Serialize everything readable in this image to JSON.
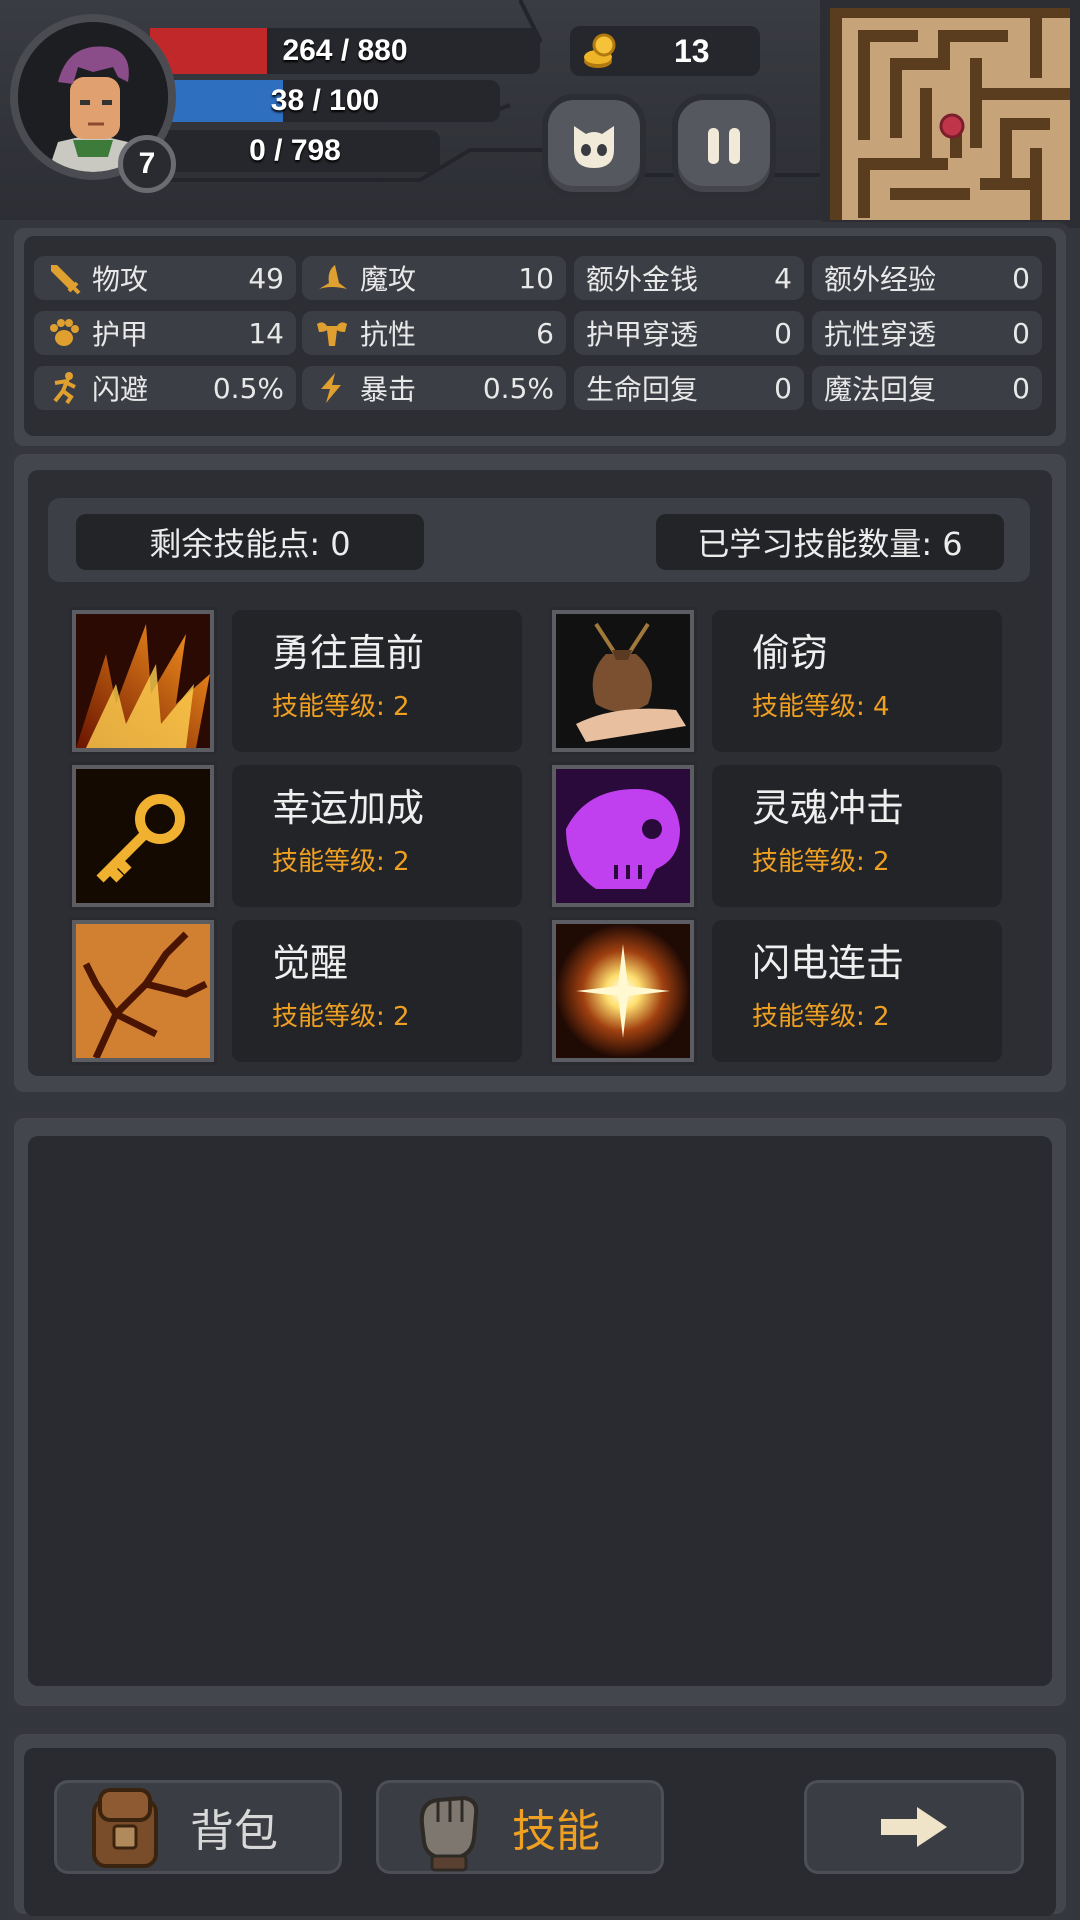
{
  "hud": {
    "level": "7",
    "hp_text": "264 / 880",
    "hp_fraction": 0.3,
    "mp_text": "38 / 100",
    "mp_fraction": 0.38,
    "xp_text": "0 / 798",
    "xp_fraction": 0,
    "gold": "13",
    "buttons": [
      "monster-guide-icon",
      "pause-icon"
    ]
  },
  "stats": [
    {
      "icon": "sword-icon",
      "label": "物攻",
      "value": "49"
    },
    {
      "icon": "wizard-hat-icon",
      "label": "魔攻",
      "value": "10"
    },
    {
      "label": "额外金钱",
      "value": "4"
    },
    {
      "label": "额外经验",
      "value": "0"
    },
    {
      "icon": "paw-armor-icon",
      "label": "护甲",
      "value": "14"
    },
    {
      "icon": "muscle-icon",
      "label": "抗性",
      "value": "6"
    },
    {
      "label": "护甲穿透",
      "value": "0"
    },
    {
      "label": "抗性穿透",
      "value": "0"
    },
    {
      "icon": "running-icon",
      "label": "闪避",
      "value": "0.5%"
    },
    {
      "icon": "lightning-icon",
      "label": "暴击",
      "value": "0.5%"
    },
    {
      "label": "生命回复",
      "value": "0"
    },
    {
      "label": "魔法回复",
      "value": "0"
    }
  ],
  "skills_header": {
    "remaining_points": "剩余技能点: 0",
    "learned_count": "已学习技能数量: 6"
  },
  "skills": [
    {
      "name": "勇往直前",
      "level": "技能等级: 2",
      "icon": "flame-claw-icon"
    },
    {
      "name": "偷窃",
      "level": "技能等级: 4",
      "icon": "money-bag-hand-icon"
    },
    {
      "name": "幸运加成",
      "level": "技能等级: 2",
      "icon": "golden-key-icon"
    },
    {
      "name": "灵魂冲击",
      "level": "技能等级: 2",
      "icon": "purple-skull-icon"
    },
    {
      "name": "觉醒",
      "level": "技能等级: 2",
      "icon": "fire-branch-icon"
    },
    {
      "name": "闪电连击",
      "level": "技能等级: 2",
      "icon": "light-burst-icon"
    }
  ],
  "nav": {
    "bag_label": "背包",
    "skills_label": "技能",
    "next_icon": "arrow-right-icon"
  },
  "colors": {
    "hp": "#c0282a",
    "mp": "#2f6fc0",
    "skill_level": "#f0a020",
    "active_nav": "#f0a020"
  }
}
